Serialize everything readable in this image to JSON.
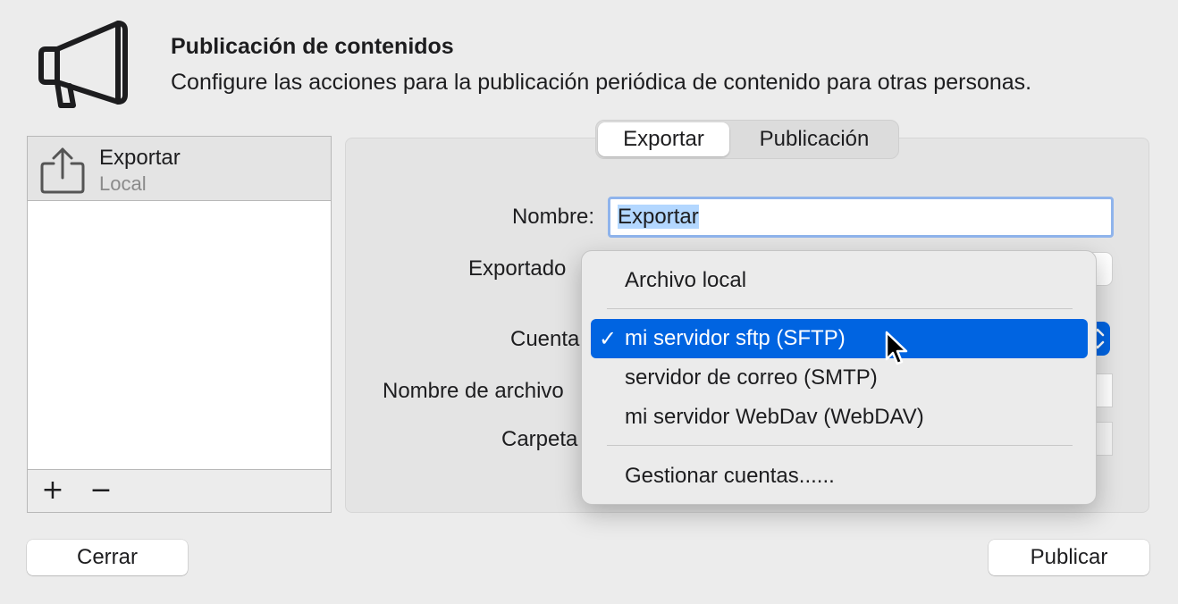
{
  "header": {
    "icon": "megaphone-icon",
    "title": "Publicación de contenidos",
    "description": "Configure las acciones para la publicación periódica de contenido para otras personas."
  },
  "sidebar": {
    "items": [
      {
        "title": "Exportar",
        "subtitle": "Local",
        "icon": "share-export-icon",
        "selected": true
      }
    ],
    "add_label": "+",
    "remove_label": "−"
  },
  "tabs": [
    {
      "label": "Exportar",
      "active": true
    },
    {
      "label": "Publicación",
      "active": false
    }
  ],
  "form": {
    "name_label": "Nombre:",
    "name_value": "Exportar",
    "exporter_label": "Exportado",
    "account_label": "Cuenta",
    "filename_label": "Nombre de archivo",
    "folder_label": "Carpeta"
  },
  "menu": {
    "items": [
      {
        "label": "Archivo local",
        "selected": false
      },
      {
        "label": "mi servidor sftp (SFTP)",
        "selected": true
      },
      {
        "label": "servidor de correo (SMTP)",
        "selected": false
      },
      {
        "label": "mi servidor WebDav (WebDAV)",
        "selected": false
      },
      {
        "label": "Gestionar cuentas......",
        "selected": false
      }
    ],
    "check_glyph": "✓"
  },
  "buttons": {
    "close_label": "Cerrar",
    "publish_label": "Publicar"
  },
  "colors": {
    "accent": "#0064e1",
    "selection": "#b3d7ff",
    "focus_ring": "#8fb4ec",
    "background": "#ececec"
  }
}
